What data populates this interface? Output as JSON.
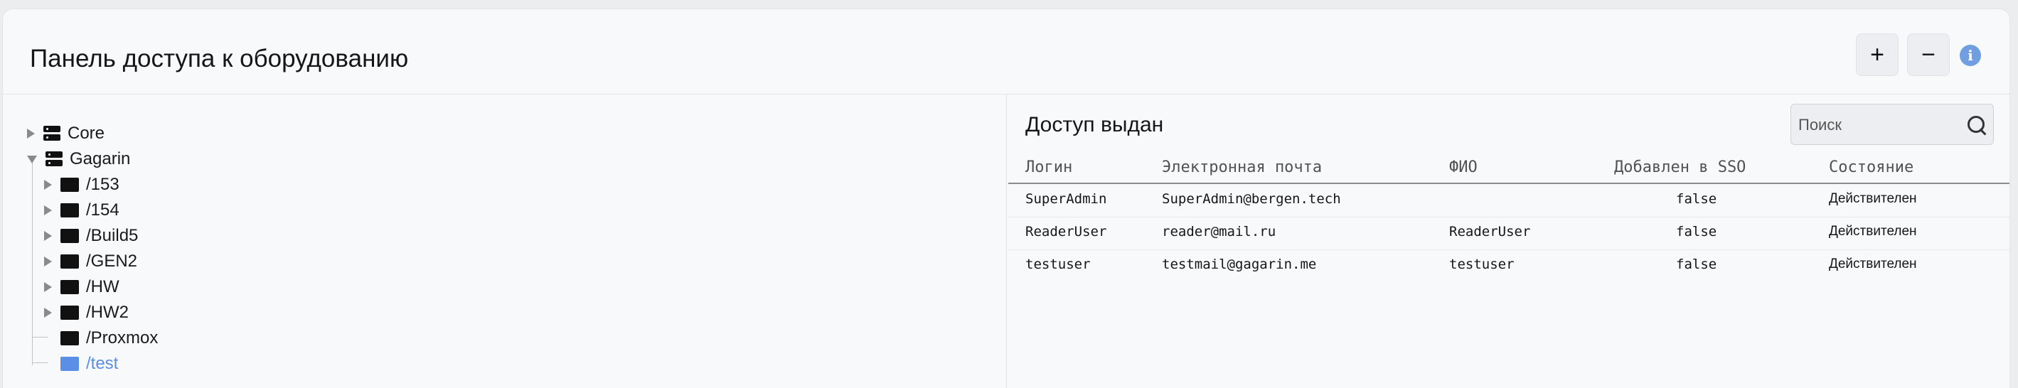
{
  "header": {
    "title": "Панель доступа к оборудованию",
    "add_label": "+",
    "remove_label": "−",
    "info_label": "i"
  },
  "tree": {
    "root_items": [
      {
        "label": "Core",
        "expanded": false,
        "icon": "server-icon"
      },
      {
        "label": "Gagarin",
        "expanded": true,
        "icon": "server-icon"
      }
    ],
    "children": [
      {
        "label": "/153",
        "expandable": true
      },
      {
        "label": "/154",
        "expandable": true
      },
      {
        "label": "/Build5",
        "expandable": true
      },
      {
        "label": "/GEN2",
        "expandable": true
      },
      {
        "label": "/HW",
        "expandable": true
      },
      {
        "label": "/HW2",
        "expandable": true
      },
      {
        "label": "/Proxmox",
        "expandable": false
      },
      {
        "label": "/test",
        "expandable": false,
        "selected": true
      }
    ],
    "selected_color": "#5b8fe6"
  },
  "access": {
    "title": "Доступ выдан",
    "search_placeholder": "Поиск",
    "columns": [
      "Логин",
      "Электронная почта",
      "ФИО",
      "Добавлен в SSO",
      "Состояние"
    ],
    "rows": [
      {
        "login": "SuperAdmin",
        "email": "SuperAdmin@bergen.tech",
        "fio": "",
        "sso": "false",
        "state": "Действителен"
      },
      {
        "login": "ReaderUser",
        "email": "reader@mail.ru",
        "fio": "ReaderUser",
        "sso": "false",
        "state": "Действителен"
      },
      {
        "login": "testuser",
        "email": "testmail@gagarin.me",
        "fio": "testuser",
        "sso": "false",
        "state": "Действителен"
      }
    ]
  }
}
